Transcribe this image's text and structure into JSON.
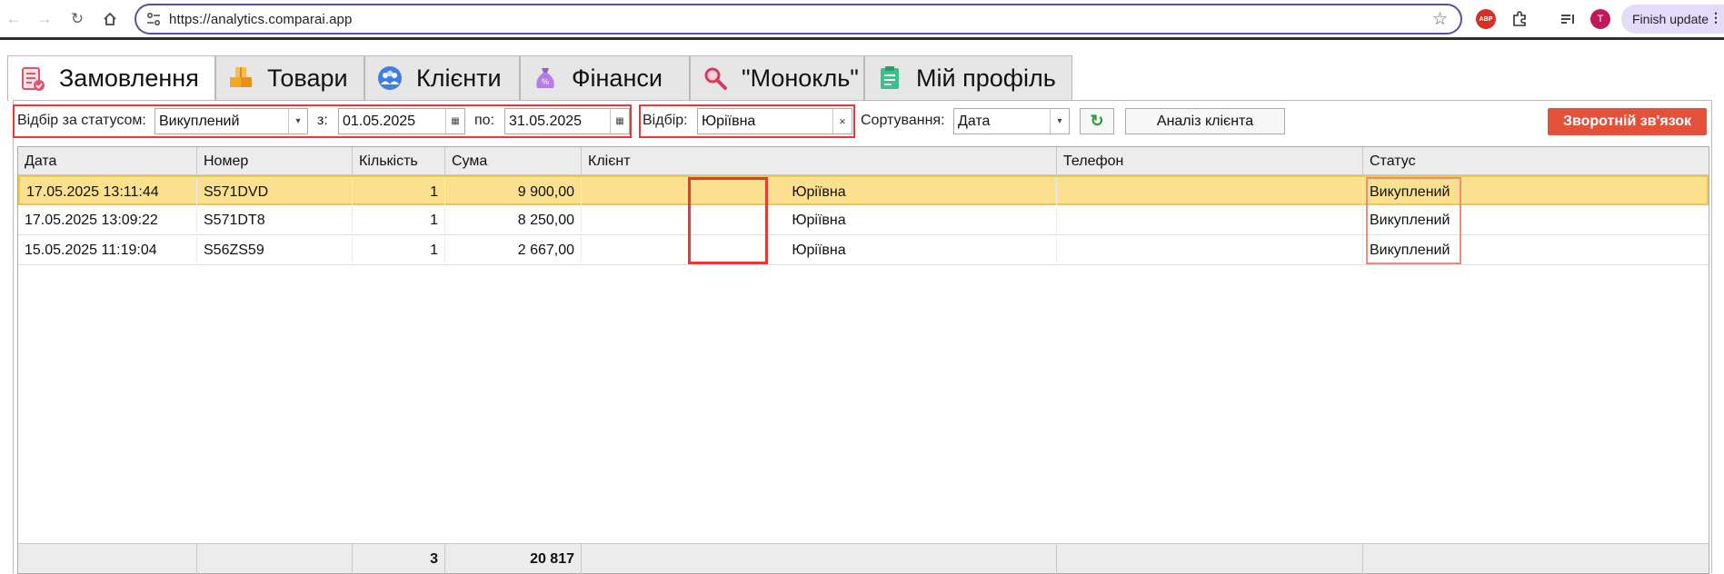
{
  "browser": {
    "url": "https://analytics.comparai.app",
    "avatar_letter": "T",
    "abp_label": "ABP",
    "finish_update_label": "Finish update"
  },
  "tabs": [
    {
      "label": "Замовлення",
      "icon": "orders-icon",
      "active": true
    },
    {
      "label": "Товари",
      "icon": "boxes-icon",
      "active": false
    },
    {
      "label": "Клієнти",
      "icon": "people-icon",
      "active": false
    },
    {
      "label": "Фінанси",
      "icon": "money-bag-icon",
      "active": false
    },
    {
      "label": "\"Монокль\"",
      "icon": "magnifier-icon",
      "active": false
    },
    {
      "label": "Мій профіль",
      "icon": "profile-icon",
      "active": false
    }
  ],
  "filters": {
    "status_label": "Відбір за статусом:",
    "status_value": "Викуплений",
    "from_label": "з:",
    "from_value": "01.05.2025",
    "to_label": "по:",
    "to_value": "31.05.2025",
    "selection_label": "Відбір:",
    "selection_value": "Юріївна",
    "clear_symbol": "×",
    "sort_label": "Сортування:",
    "sort_value": "Дата",
    "analysis_button": "Аналіз клієнта",
    "feedback_button": "Зворотній зв'язок"
  },
  "table": {
    "columns": [
      "Дата",
      "Номер",
      "Кількість",
      "Сума",
      "Клієнт",
      "Телефон",
      "Статус"
    ],
    "rows": [
      {
        "date": "17.05.2025 13:11:44",
        "number": "S571DVD",
        "qty": "1",
        "sum": "9 900,00",
        "client": "Юріївна",
        "phone": "",
        "status": "Викуплений"
      },
      {
        "date": "17.05.2025 13:09:22",
        "number": "S571DT8",
        "qty": "1",
        "sum": "8 250,00",
        "client": "Юріївна",
        "phone": "",
        "status": "Викуплений"
      },
      {
        "date": "15.05.2025 11:19:04",
        "number": "S56ZS59",
        "qty": "1",
        "sum": "2 667,00",
        "client": "Юріївна",
        "phone": "",
        "status": "Викуплений"
      }
    ],
    "totals": {
      "qty": "3",
      "sum": "20 817"
    }
  },
  "colors": {
    "selected_row": "#fae08f",
    "highlight_border": "#e53935",
    "feedback_button": "#e4513a",
    "omnibox_border": "#5b4ea0"
  }
}
